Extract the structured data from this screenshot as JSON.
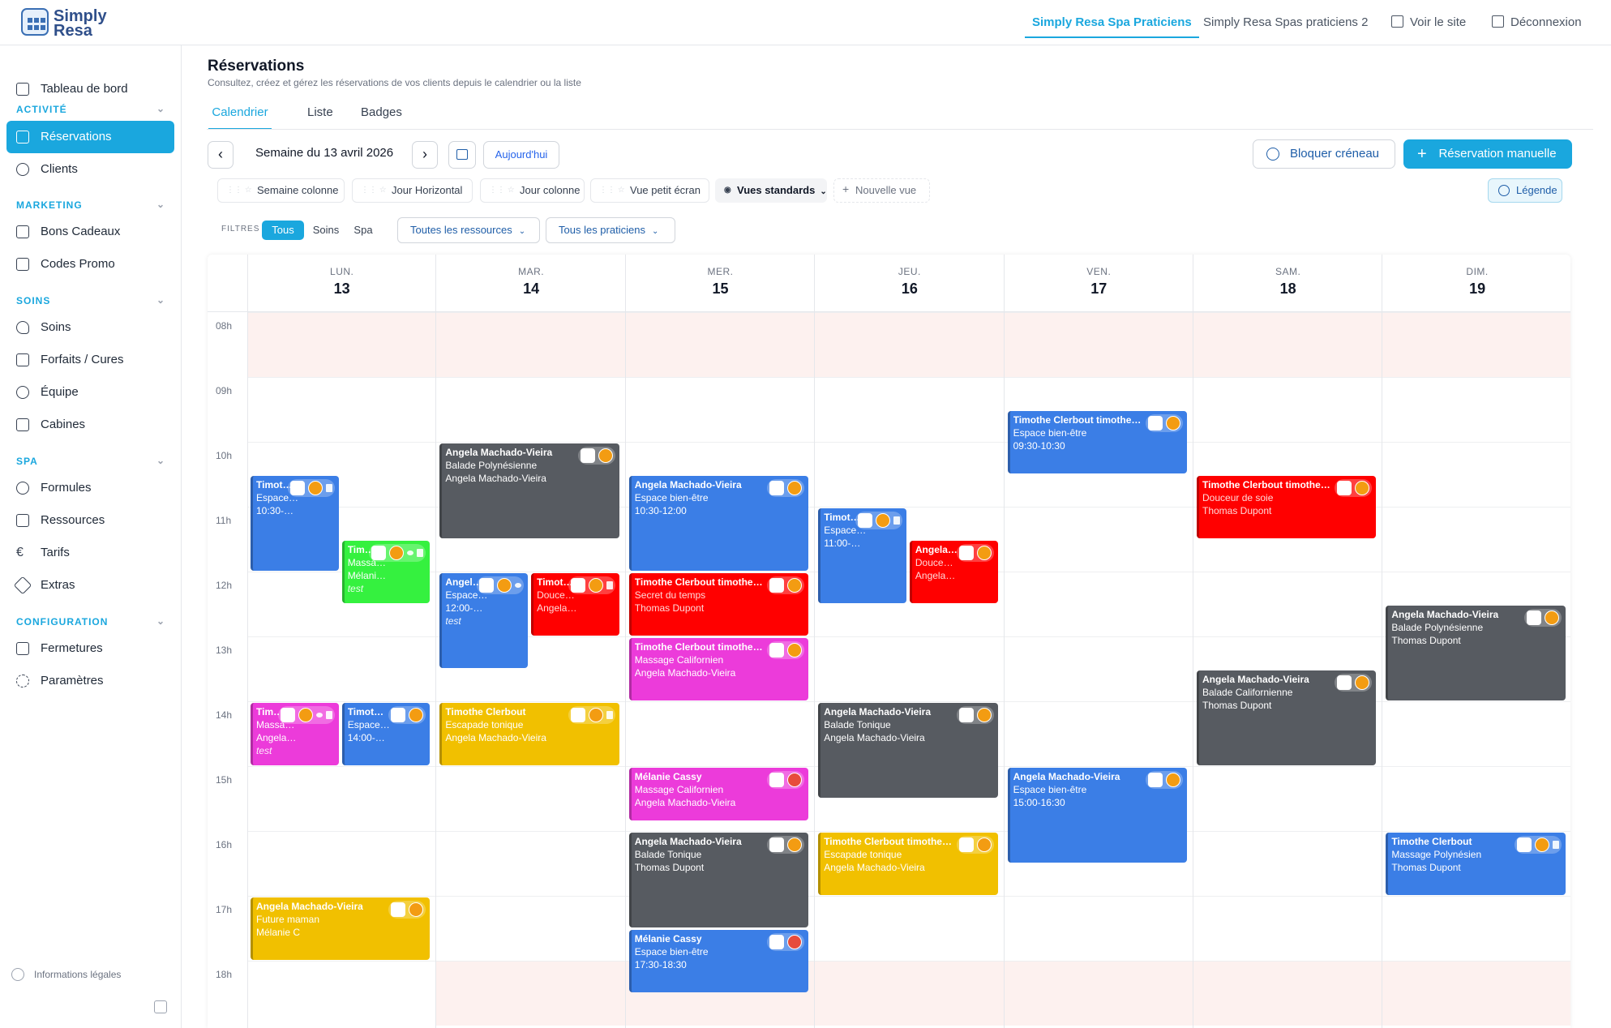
{
  "brand": {
    "line1": "Simply",
    "line2": "Resa"
  },
  "topnav": {
    "active_tab": "Simply Resa Spa Praticiens",
    "tab2": "Simply Resa Spas praticiens 2",
    "view_site": "Voir le site",
    "logout": "Déconnexion"
  },
  "sidebar": {
    "dashboard": "Tableau de bord",
    "sections": [
      {
        "title": "ACTIVITÉ",
        "items": [
          "Réservations",
          "Clients"
        ]
      },
      {
        "title": "MARKETING",
        "items": [
          "Bons Cadeaux",
          "Codes Promo"
        ]
      },
      {
        "title": "SOINS",
        "items": [
          "Soins",
          "Forfaits / Cures",
          "Équipe",
          "Cabines"
        ]
      },
      {
        "title": "SPA",
        "items": [
          "Formules",
          "Ressources",
          "Tarifs",
          "Extras"
        ]
      },
      {
        "title": "CONFIGURATION",
        "items": [
          "Fermetures",
          "Paramètres"
        ]
      }
    ],
    "legal": "Informations légales"
  },
  "page": {
    "title": "Réservations",
    "subtitle": "Consultez, créez et gérez les réservations de vos clients depuis le calendrier ou la liste"
  },
  "tabs": [
    "Calendrier",
    "Liste",
    "Badges"
  ],
  "toolbar": {
    "week_label": "Semaine du 13 avril 2026",
    "today": "Aujourd'hui",
    "block": "Bloquer créneau",
    "manual": "Réservation manuelle"
  },
  "views": [
    "Semaine colonne",
    "Jour Horizontal",
    "Jour colonne",
    "Vue petit écran",
    "Vues standards",
    "Nouvelle vue"
  ],
  "legend": "Légende",
  "filters": {
    "label": "FILTRES",
    "chips": [
      "Tous",
      "Soins",
      "Spa"
    ],
    "resources": "Toutes les ressources",
    "practitioners": "Tous les praticiens"
  },
  "calendar": {
    "days": [
      {
        "name": "LUN.",
        "num": "13"
      },
      {
        "name": "MAR.",
        "num": "14"
      },
      {
        "name": "MER.",
        "num": "15"
      },
      {
        "name": "JEU.",
        "num": "16"
      },
      {
        "name": "VEN.",
        "num": "17"
      },
      {
        "name": "SAM.",
        "num": "18"
      },
      {
        "name": "DIM.",
        "num": "19"
      }
    ],
    "hours": [
      "08h",
      "09h",
      "10h",
      "11h",
      "12h",
      "13h",
      "14h",
      "15h",
      "16h",
      "17h",
      "18h"
    ],
    "events": [
      {
        "day": 0,
        "start": 10.5,
        "end": 12,
        "lane": 0,
        "lanes": 2,
        "color": "blue",
        "title": "Timot…",
        "l2": "Espace…",
        "l3": "10:30-…",
        "dot": "o",
        "mini": "c"
      },
      {
        "day": 0,
        "start": 11.5,
        "end": 12.5,
        "lane": 1,
        "lanes": 2,
        "color": "green",
        "title": "Tim…",
        "l2": "Massa…",
        "l3": "Mélani…",
        "l4": "test",
        "dot": "o",
        "mini": "oc"
      },
      {
        "day": 0,
        "start": 14,
        "end": 15,
        "lane": 0,
        "lanes": 2,
        "color": "pink",
        "title": "Tim…",
        "l2": "Massa…",
        "l3": "Angela…",
        "l4": "test",
        "dot": "o",
        "mini": "oc"
      },
      {
        "day": 0,
        "start": 14,
        "end": 15,
        "lane": 1,
        "lanes": 2,
        "color": "blue",
        "title": "Timot…",
        "l2": "Espace…",
        "l3": "14:00-…",
        "dot": "o"
      },
      {
        "day": 0,
        "start": 17,
        "end": 18,
        "lane": 0,
        "lanes": 1,
        "color": "yellow",
        "title": "Angela Machado-Vieira",
        "l2": "Future maman",
        "l3": "Mélanie C",
        "dot": "o"
      },
      {
        "day": 1,
        "start": 10,
        "end": 11.5,
        "lane": 0,
        "lanes": 1,
        "color": "gray",
        "title": "Angela Machado-Vieira",
        "l2": "Balade Polynésienne",
        "l3": "Angela Machado-Vieira",
        "dot": "o"
      },
      {
        "day": 1,
        "start": 12,
        "end": 13.5,
        "lane": 0,
        "lanes": 2,
        "color": "blue",
        "title": "Angel…",
        "l2": "Espace…",
        "l3": "12:00-…",
        "l4": "test",
        "dot": "o",
        "mini": "o"
      },
      {
        "day": 1,
        "start": 12,
        "end": 13,
        "lane": 1,
        "lanes": 2,
        "color": "red",
        "title": "Timot…",
        "l2": "Douce…",
        "l3": "Angela…",
        "dot": "o",
        "mini": "c"
      },
      {
        "day": 1,
        "start": 14,
        "end": 15,
        "lane": 0,
        "lanes": 1,
        "color": "yellow",
        "title": "Timothe Clerbout",
        "l2": "Escapade tonique",
        "l3": "Angela Machado-Vieira",
        "dot": "o",
        "mini": "c"
      },
      {
        "day": 2,
        "start": 10.5,
        "end": 12,
        "lane": 0,
        "lanes": 1,
        "color": "blue",
        "title": "Angela Machado-Vieira",
        "l2": "Espace bien-être",
        "l3": "10:30-12:00",
        "dot": "o"
      },
      {
        "day": 2,
        "start": 12,
        "end": 13,
        "lane": 0,
        "lanes": 1,
        "color": "red",
        "title": "Timothe Clerbout timothe…",
        "l2": "Secret du temps",
        "l3": "Thomas Dupont",
        "dot": "o"
      },
      {
        "day": 2,
        "start": 13,
        "end": 14,
        "lane": 0,
        "lanes": 1,
        "color": "pink",
        "title": "Timothe Clerbout timothe…",
        "l2": "Massage Californien",
        "l3": "Angela Machado-Vieira",
        "dot": "o"
      },
      {
        "day": 2,
        "start": 15,
        "end": 15.85,
        "lane": 0,
        "lanes": 1,
        "color": "pink",
        "title": "Mélanie Cassy",
        "l2": "Massage Californien",
        "l3": "Angela Machado-Vieira",
        "dot": "r"
      },
      {
        "day": 2,
        "start": 16,
        "end": 17.5,
        "lane": 0,
        "lanes": 1,
        "color": "gray",
        "title": "Angela Machado-Vieira",
        "l2": "Balade Tonique",
        "l3": "Thomas Dupont",
        "dot": "o"
      },
      {
        "day": 2,
        "start": 17.5,
        "end": 18.5,
        "lane": 0,
        "lanes": 1,
        "color": "blue",
        "title": "Mélanie Cassy",
        "l2": "Espace bien-être",
        "l3": "17:30-18:30",
        "dot": "r"
      },
      {
        "day": 3,
        "start": 11,
        "end": 12.5,
        "lane": 0,
        "lanes": 2,
        "color": "blue",
        "title": "Timot…",
        "l2": "Espace…",
        "l3": "11:00-…",
        "dot": "o",
        "mini": "c"
      },
      {
        "day": 3,
        "start": 11.5,
        "end": 12.5,
        "lane": 1,
        "lanes": 2,
        "color": "red",
        "title": "Angela…",
        "l2": "Douce…",
        "l3": "Angela…",
        "dot": "o"
      },
      {
        "day": 3,
        "start": 14,
        "end": 15.5,
        "lane": 0,
        "lanes": 1,
        "color": "gray",
        "title": "Angela Machado-Vieira",
        "l2": "Balade Tonique",
        "l3": "Angela Machado-Vieira",
        "dot": "o"
      },
      {
        "day": 3,
        "start": 16,
        "end": 17,
        "lane": 0,
        "lanes": 1,
        "color": "yellow",
        "title": "Timothe Clerbout timothe…",
        "l2": "Escapade tonique",
        "l3": "Angela Machado-Vieira",
        "dot": "o"
      },
      {
        "day": 4,
        "start": 9.5,
        "end": 10.5,
        "lane": 0,
        "lanes": 1,
        "color": "blue",
        "title": "Timothe Clerbout timothe…",
        "l2": "Espace bien-être",
        "l3": "09:30-10:30",
        "dot": "o"
      },
      {
        "day": 4,
        "start": 15,
        "end": 16.5,
        "lane": 0,
        "lanes": 1,
        "color": "blue",
        "title": "Angela Machado-Vieira",
        "l2": "Espace bien-être",
        "l3": "15:00-16:30",
        "dot": "o"
      },
      {
        "day": 5,
        "start": 10.5,
        "end": 11.5,
        "lane": 0,
        "lanes": 1,
        "color": "red",
        "title": "Timothe Clerbout timothe…",
        "l2": "Douceur de soie",
        "l3": "Thomas Dupont",
        "dot": "o"
      },
      {
        "day": 5,
        "start": 13.5,
        "end": 15,
        "lane": 0,
        "lanes": 1,
        "color": "gray",
        "title": "Angela Machado-Vieira",
        "l2": "Balade Californienne",
        "l3": "Thomas Dupont",
        "dot": "o"
      },
      {
        "day": 6,
        "start": 12.5,
        "end": 14,
        "lane": 0,
        "lanes": 1,
        "color": "gray",
        "title": "Angela Machado-Vieira",
        "l2": "Balade Polynésienne",
        "l3": "Thomas Dupont",
        "dot": "o"
      },
      {
        "day": 6,
        "start": 16,
        "end": 17,
        "lane": 0,
        "lanes": 1,
        "color": "blue",
        "title": "Timothe Clerbout",
        "l2": "Massage Polynésien",
        "l3": "Thomas Dupont",
        "dot": "o",
        "mini": "c"
      }
    ]
  }
}
